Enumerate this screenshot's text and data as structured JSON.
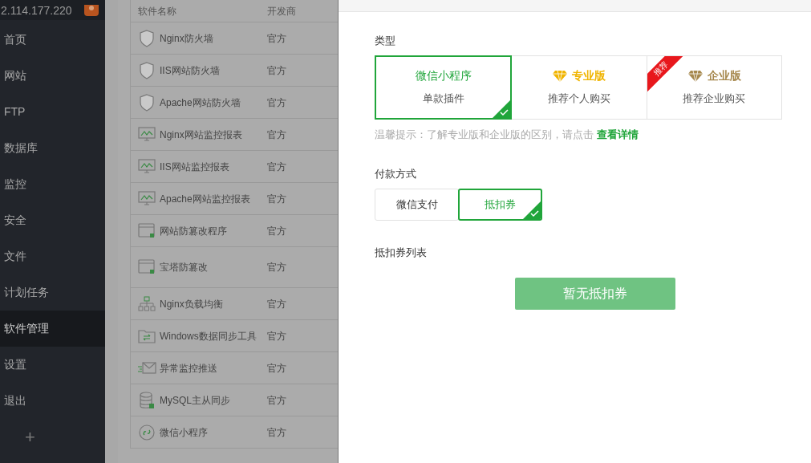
{
  "sidebar": {
    "server_ip": "2.114.177.220",
    "items": [
      {
        "label": "首页",
        "selected": false
      },
      {
        "label": "网站",
        "selected": false
      },
      {
        "label": "FTP",
        "selected": false
      },
      {
        "label": "数据库",
        "selected": false
      },
      {
        "label": "监控",
        "selected": false
      },
      {
        "label": "安全",
        "selected": false
      },
      {
        "label": "文件",
        "selected": false
      },
      {
        "label": "计划任务",
        "selected": false
      },
      {
        "label": "软件管理",
        "selected": true
      },
      {
        "label": "设置",
        "selected": false
      },
      {
        "label": "退出",
        "selected": false
      }
    ],
    "add_button": "+"
  },
  "table": {
    "columns": [
      "软件名称",
      "开发商"
    ],
    "rows": [
      {
        "kind": "waf",
        "name": "Nginx防火墙",
        "developer": "官方"
      },
      {
        "kind": "waf",
        "name": "IIS网站防火墙",
        "developer": "官方"
      },
      {
        "kind": "waf",
        "name": "Apache网站防火墙",
        "developer": "官方"
      },
      {
        "kind": "monitor",
        "name": "Nginx网站监控报表",
        "developer": "官方"
      },
      {
        "kind": "monitor",
        "name": "IIS网站监控报表",
        "developer": "官方"
      },
      {
        "kind": "monitor",
        "name": "Apache网站监控报表",
        "developer": "官方"
      },
      {
        "kind": "window",
        "name": "网站防篡改程序",
        "developer": "官方"
      },
      {
        "kind": "window",
        "name": "宝塔防篡改",
        "developer": "官方"
      },
      {
        "kind": "network",
        "name": "Nginx负载均衡",
        "developer": "官方"
      },
      {
        "kind": "folder",
        "name": "Windows数据同步工具",
        "developer": "官方"
      },
      {
        "kind": "mail",
        "name": "异常监控推送",
        "developer": "官方"
      },
      {
        "kind": "database",
        "name": "MySQL主从同步",
        "developer": "官方"
      },
      {
        "kind": "link",
        "name": "微信小程序",
        "developer": "官方"
      }
    ]
  },
  "dialog": {
    "type_label": "类型",
    "types": [
      {
        "kind": "plain",
        "title": "微信小程序",
        "subtitle": "单款插件",
        "selected": true
      },
      {
        "kind": "pro",
        "title": "专业版",
        "subtitle": "推荐个人购买",
        "selected": false
      },
      {
        "kind": "enterprise",
        "title": "企业版",
        "subtitle": "推荐企业购买",
        "selected": false,
        "ribbon": "推荐"
      }
    ],
    "hint": "温馨提示：了解专业版和企业版的区别，请点击",
    "hint_link": "查看详情",
    "payment_label": "付款方式",
    "payments": [
      {
        "label": "微信支付",
        "selected": false
      },
      {
        "label": "抵扣券",
        "selected": true
      }
    ],
    "coupon_label": "抵扣券列表",
    "coupon_button": "暂无抵扣券"
  }
}
